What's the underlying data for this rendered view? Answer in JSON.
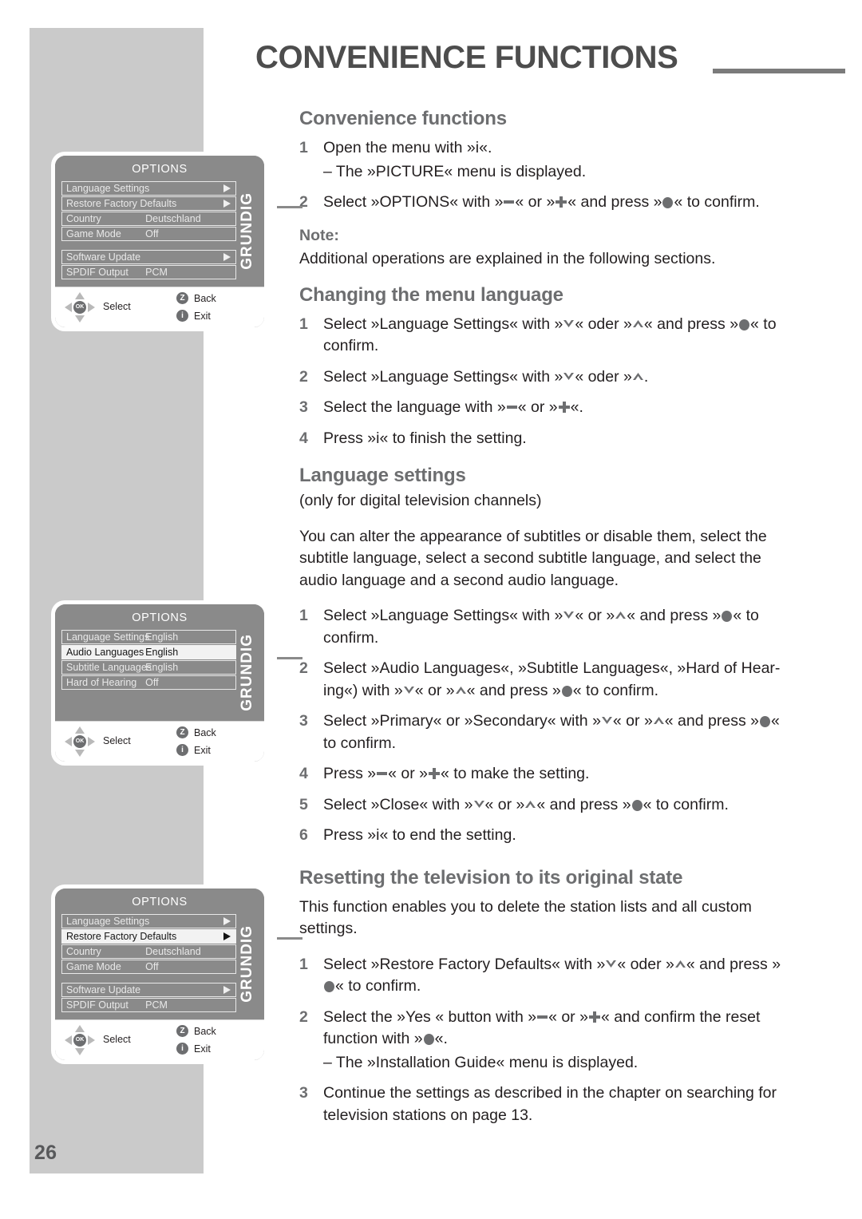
{
  "page": {
    "number": "26",
    "chapter_title": "CONVENIENCE FUNCTIONS"
  },
  "sections": {
    "convenience": {
      "heading": "Convenience functions",
      "step1": "Open the menu with »i«.",
      "step1_sub": "–  The »PICTURE« menu is displayed.",
      "step2_a": "Select »OPTIONS« with »",
      "step2_b": "« or »",
      "step2_c": "« and press »",
      "step2_d": "« to confirm.",
      "note_label": "Note:",
      "note_text": "Additional operations are explained in the following sections."
    },
    "menu_language": {
      "heading": "Changing the menu language",
      "step1_a": "Select »Language Settings« with »",
      "step1_b": "« oder »",
      "step1_c": "« and press »",
      "step1_d": "« to confirm.",
      "step2_a": "Select »Language Settings« with »",
      "step2_b": "« oder »",
      "step2_c": ".",
      "step3_a": "Select the language with »",
      "step3_b": "« or »",
      "step3_c": "«.",
      "step4": "Press »i« to finish the setting."
    },
    "language_settings": {
      "heading": "Language settings",
      "subtitle": "(only for digital television channels)",
      "intro": "You can alter the appearance of subtitles or disable them, select the subtitle language, select a second subtitle language, and select the audio language and a second audio language.",
      "step1_a": "Select »Language Settings« with »",
      "step1_b": "« or »",
      "step1_c": "« and press »",
      "step1_d": "« to confirm.",
      "step2_a": "Select »Audio Languages«, »Subtitle Languages«, »Hard of Hear-ing«) with »",
      "step2_b": "« or »",
      "step2_c": "« and press »",
      "step2_d": "« to confirm.",
      "step3_a": "Select »Primary« or »Secondary« with »",
      "step3_b": "« or »",
      "step3_c": "« and press »",
      "step3_d": "« to confirm.",
      "step4_a": "Press »",
      "step4_b": "« or »",
      "step4_c": "« to make the setting.",
      "step5_a": "Select »Close« with »",
      "step5_b": "« or »",
      "step5_c": "« and press »",
      "step5_d": "« to confirm.",
      "step6": "Press »i« to end the setting."
    },
    "resetting": {
      "heading": "Resetting the television to its original state",
      "intro": "This function enables you to delete the station lists and all custom settings.",
      "step1_a": "Select »Restore Factory Defaults« with »",
      "step1_b": "« oder »",
      "step1_c": "« and press »",
      "step1_d": "« to confirm.",
      "step2_a": "Select the »Yes « button with »",
      "step2_b": "« or »",
      "step2_c": "« and confirm the reset function with »",
      "step2_d": "«.",
      "step2_sub": "–  The »Installation Guide« menu is displayed.",
      "step3": "Continue the settings as described in the chapter on searching for television stations on page 13."
    }
  },
  "tv_menus": [
    {
      "title": "OPTIONS",
      "brand": "GRUNDIG",
      "rows": [
        {
          "label": "Language Settings",
          "value": "",
          "arrow": true,
          "selected": false
        },
        {
          "label": "Restore Factory Defaults",
          "value": "",
          "arrow": true,
          "selected": false
        },
        {
          "label": "Country",
          "value": "Deutschland",
          "arrow": false,
          "selected": false
        },
        {
          "label": "Game Mode",
          "value": "Off",
          "arrow": false,
          "selected": false
        },
        {
          "gap": true
        },
        {
          "label": "Software Update",
          "value": "",
          "arrow": true,
          "selected": false
        },
        {
          "label": "SPDIF Output",
          "value": "PCM",
          "arrow": false,
          "selected": false
        }
      ],
      "footer": {
        "ok_label": "OK",
        "select_label": "Select",
        "back_key": "Z",
        "back_label": "Back",
        "exit_key": "i",
        "exit_label": "Exit"
      }
    },
    {
      "title": "OPTIONS",
      "brand": "GRUNDIG",
      "rows": [
        {
          "label": "Language Settings",
          "value": "English",
          "arrow": false,
          "selected": false
        },
        {
          "label": "Audio Languages",
          "value": "English",
          "arrow": false,
          "selected": true
        },
        {
          "label": "Subtitle Languages",
          "value": "English",
          "arrow": false,
          "selected": false
        },
        {
          "label": "Hard of Hearing",
          "value": "Off",
          "arrow": false,
          "selected": false
        },
        {
          "gap": true
        },
        {
          "filler": true
        },
        {
          "filler": true
        }
      ],
      "footer": {
        "ok_label": "OK",
        "select_label": "Select",
        "back_key": "Z",
        "back_label": "Back",
        "exit_key": "i",
        "exit_label": "Exit"
      }
    },
    {
      "title": "OPTIONS",
      "brand": "GRUNDIG",
      "rows": [
        {
          "label": "Language Settings",
          "value": "",
          "arrow": true,
          "selected": false
        },
        {
          "label": "Restore Factory Defaults",
          "value": "",
          "arrow": true,
          "selected": true
        },
        {
          "label": "Country",
          "value": "Deutschland",
          "arrow": false,
          "selected": false
        },
        {
          "label": "Game Mode",
          "value": "Off",
          "arrow": false,
          "selected": false
        },
        {
          "gap": true
        },
        {
          "label": "Software Update",
          "value": "",
          "arrow": true,
          "selected": false
        },
        {
          "label": "SPDIF Output",
          "value": "PCM",
          "arrow": false,
          "selected": false
        }
      ],
      "footer": {
        "ok_label": "OK",
        "select_label": "Select",
        "back_key": "Z",
        "back_label": "Back",
        "exit_key": "i",
        "exit_label": "Exit"
      }
    }
  ],
  "colors": {
    "band": "#cacaca",
    "heading": "#6d6e70",
    "title": "#4d4d4d",
    "menu_bg": "#8a8a8a",
    "body_text": "#231f20"
  }
}
